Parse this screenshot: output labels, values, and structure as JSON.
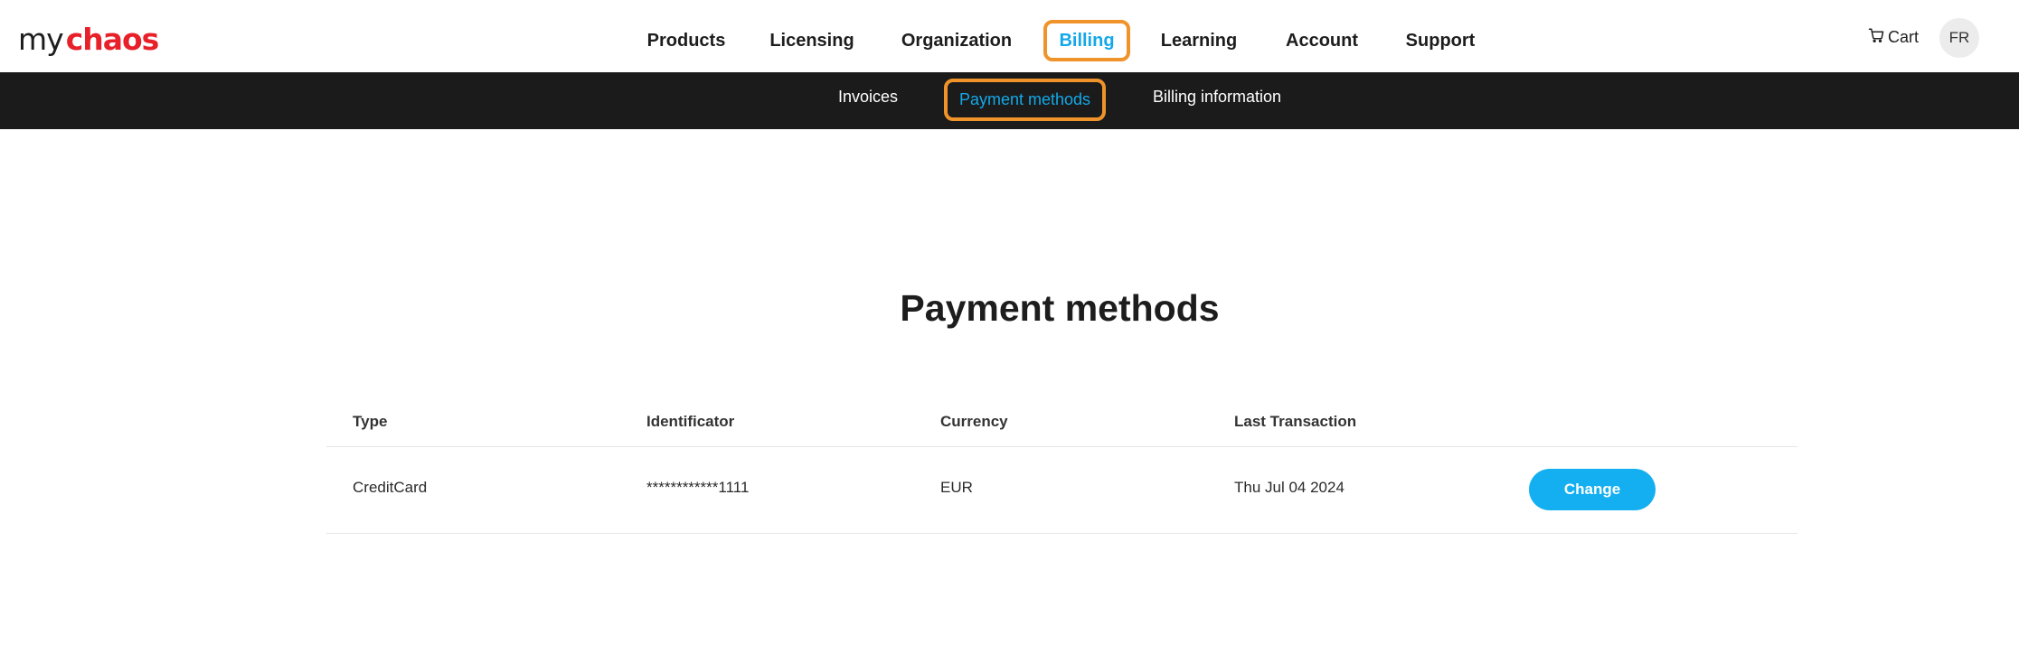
{
  "brand": {
    "my": "my",
    "chaos": "chaos"
  },
  "nav": {
    "items": [
      {
        "label": "Products"
      },
      {
        "label": "Licensing"
      },
      {
        "label": "Organization"
      },
      {
        "label": "Billing"
      },
      {
        "label": "Learning"
      },
      {
        "label": "Account"
      },
      {
        "label": "Support"
      }
    ],
    "cart_label": "Cart",
    "avatar_initials": "FR"
  },
  "subnav": {
    "items": [
      {
        "label": "Invoices"
      },
      {
        "label": "Payment methods"
      },
      {
        "label": "Billing information"
      }
    ]
  },
  "page": {
    "title": "Payment methods"
  },
  "table": {
    "columns": [
      "Type",
      "Identificator",
      "Currency",
      "Last Transaction"
    ],
    "rows": [
      {
        "type": "CreditCard",
        "identificator": "************1111",
        "currency": "EUR",
        "last_transaction": "Thu Jul 04 2024",
        "action_label": "Change"
      }
    ]
  },
  "colors": {
    "accent": "#13a8e8",
    "brand_red": "#e8202a",
    "subnav_bg": "#1b1b1b",
    "highlight": "#f0932a",
    "button": "#13aff0"
  },
  "icons": {
    "cart": "cart-icon"
  }
}
